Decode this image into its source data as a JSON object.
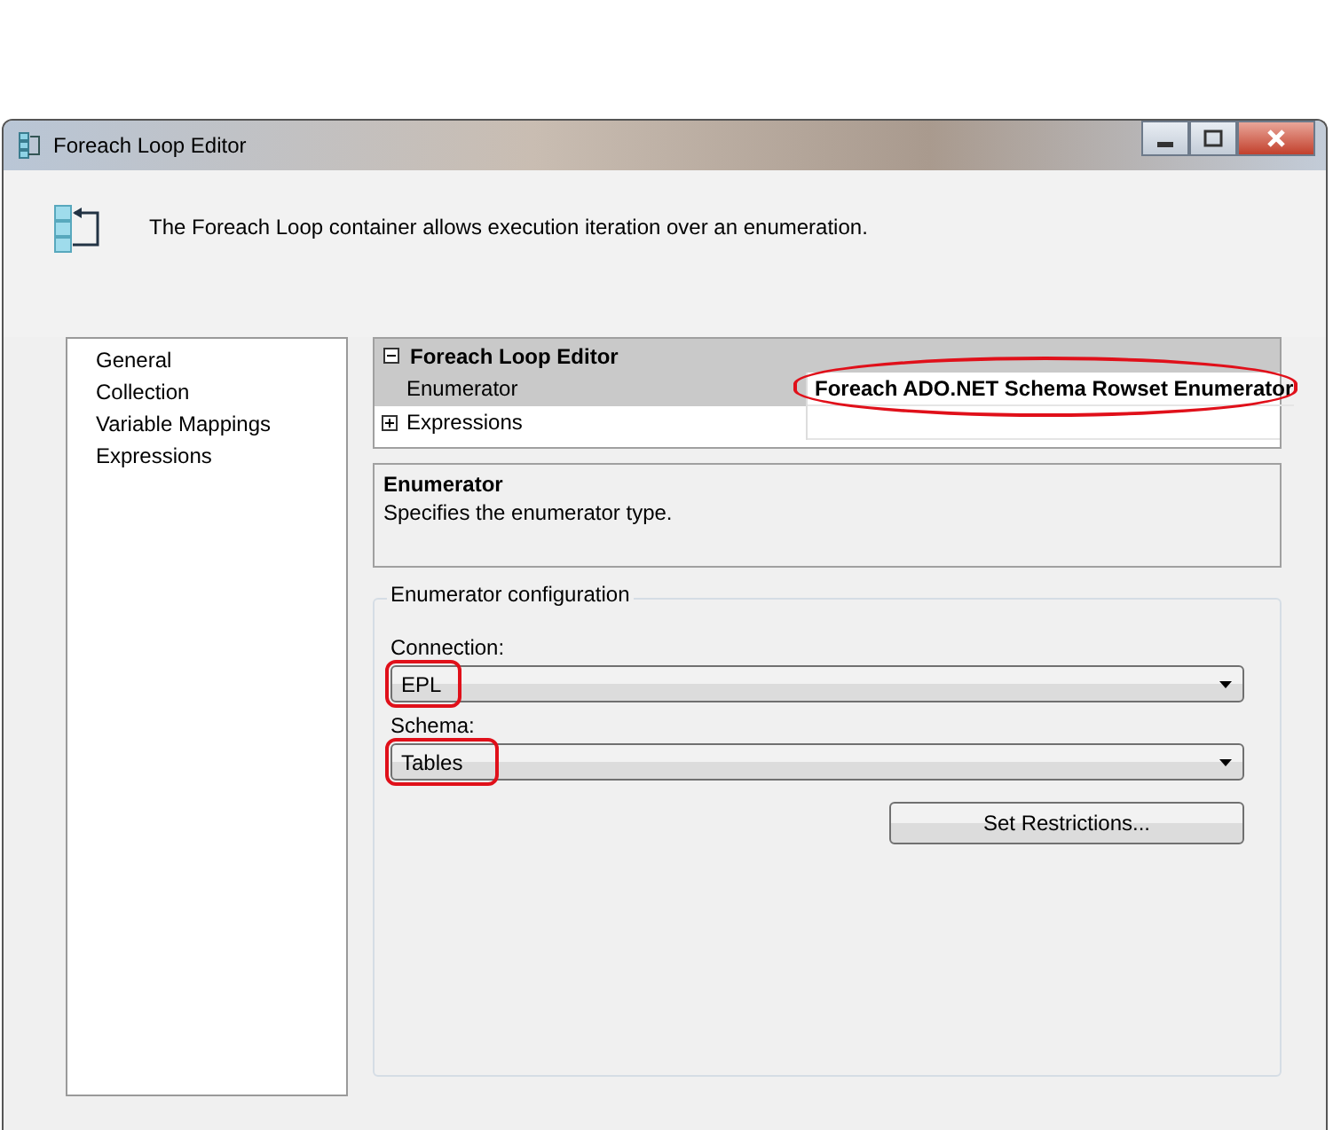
{
  "window": {
    "title": "Foreach Loop Editor"
  },
  "header": {
    "description": "The Foreach Loop container allows execution iteration over an enumeration."
  },
  "nav": {
    "items": [
      {
        "label": "General"
      },
      {
        "label": "Collection"
      },
      {
        "label": "Variable Mappings"
      },
      {
        "label": "Expressions"
      }
    ]
  },
  "properties": {
    "category": {
      "label": "Foreach Loop Editor",
      "expanded": true
    },
    "rows": [
      {
        "kind": "property",
        "name": "Enumerator",
        "value": "Foreach ADO.NET Schema Rowset Enumerator",
        "highlighted": true
      },
      {
        "kind": "category",
        "name": "Expressions",
        "expanded": false
      }
    ]
  },
  "description_panel": {
    "title": "Enumerator",
    "text": "Specifies the enumerator type."
  },
  "config": {
    "title": "Enumerator configuration",
    "fields": [
      {
        "label": "Connection:",
        "value": "EPL",
        "highlighted": true
      },
      {
        "label": "Schema:",
        "value": "Tables",
        "highlighted": true
      }
    ],
    "button": "Set Restrictions..."
  }
}
